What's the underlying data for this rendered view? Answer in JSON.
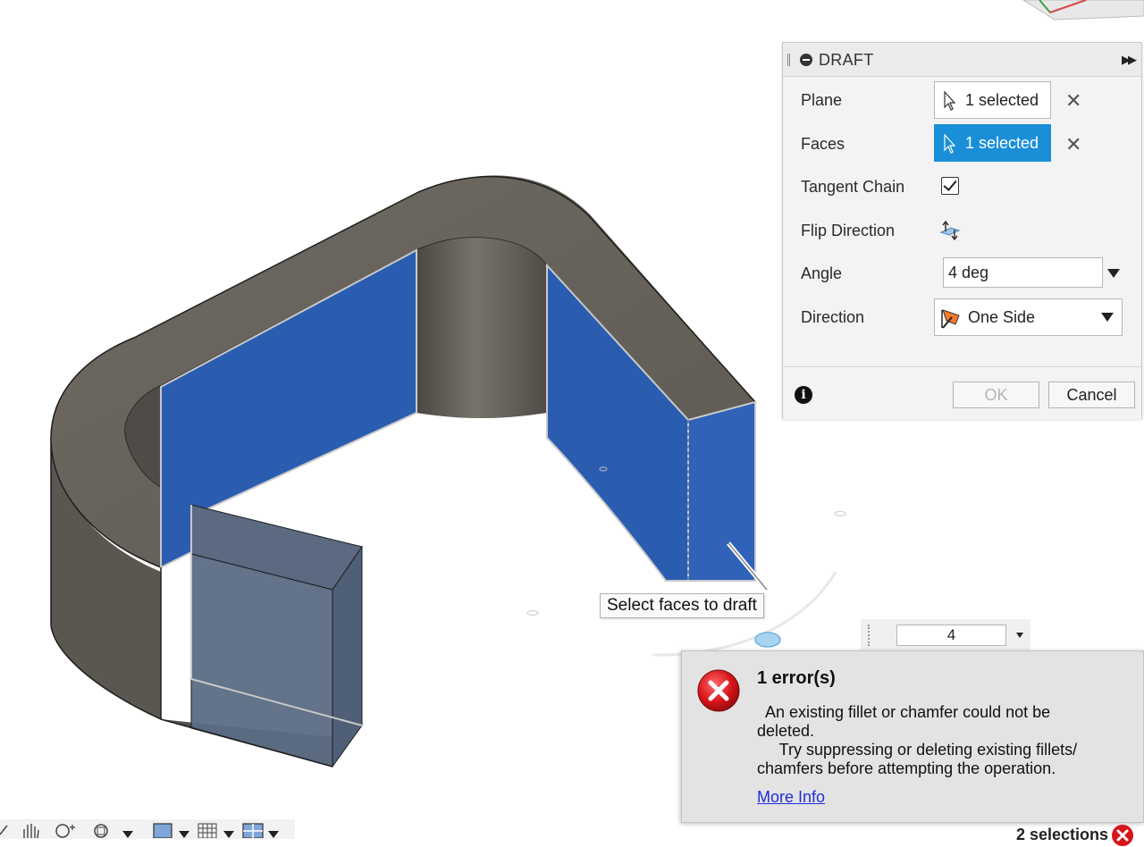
{
  "draft_panel": {
    "title": "DRAFT",
    "rows": {
      "plane": {
        "label": "Plane",
        "value": "1 selected"
      },
      "faces": {
        "label": "Faces",
        "value": "1 selected"
      },
      "tangent_chain": {
        "label": "Tangent Chain",
        "checked": true
      },
      "flip_direction": {
        "label": "Flip Direction"
      },
      "angle": {
        "label": "Angle",
        "value": "4 deg"
      },
      "direction": {
        "label": "Direction",
        "value": "One Side"
      }
    },
    "ok_label": "OK",
    "cancel_label": "Cancel"
  },
  "tooltip": {
    "text": "Select faces to draft"
  },
  "manipulator": {
    "value": "4"
  },
  "error": {
    "title": "1 error(s)",
    "line1": "  An existing fillet or chamfer could not be",
    "line2": "deleted.",
    "line3": "     Try suppressing or deleting existing fillets/",
    "line4": "chamfers before attempting the operation.",
    "link": "More Info"
  },
  "status": {
    "selections": "2 selections"
  },
  "colors": {
    "selected_face": "#2a5db0",
    "active_button": "#1a8fd8",
    "model_body": "#6b675f",
    "error_red": "#d7141a"
  }
}
